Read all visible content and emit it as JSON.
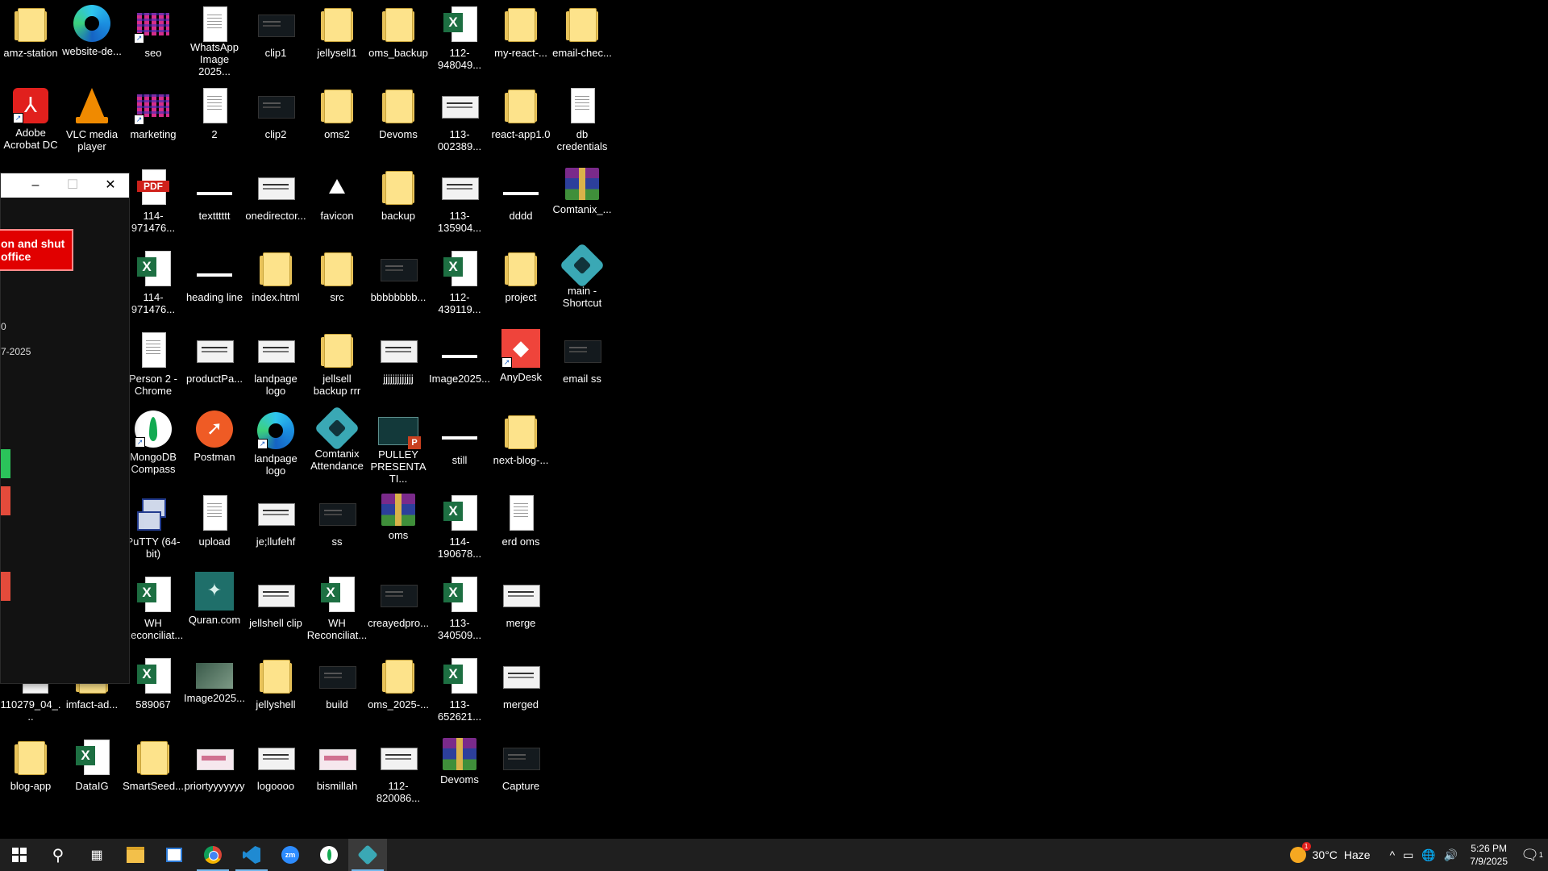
{
  "desktop_icons": [
    {
      "label": "amz-station",
      "type": "folder"
    },
    {
      "label": "website-de...",
      "type": "edge"
    },
    {
      "label": "seo",
      "type": "bars"
    },
    {
      "label": "WhatsApp Image 2025...",
      "type": "doc"
    },
    {
      "label": "clip1",
      "type": "darkimg"
    },
    {
      "label": "jellysell1",
      "type": "folder"
    },
    {
      "label": "oms_backup",
      "type": "folder"
    },
    {
      "label": "112-948049...",
      "type": "excel"
    },
    {
      "label": "my-react-...",
      "type": "folder"
    },
    {
      "label": "email-chec...",
      "type": "folder"
    },
    {
      "label": "Adobe Acrobat DC",
      "type": "acrobat"
    },
    {
      "label": "VLC media player",
      "type": "vlc"
    },
    {
      "label": "marketing",
      "type": "bars"
    },
    {
      "label": "2",
      "type": "doc"
    },
    {
      "label": "clip2",
      "type": "darkimg"
    },
    {
      "label": "oms2",
      "type": "folder"
    },
    {
      "label": "Devoms",
      "type": "folder"
    },
    {
      "label": "113-002389...",
      "type": "image"
    },
    {
      "label": "react-app1.0",
      "type": "folder"
    },
    {
      "label": "db credentials",
      "type": "doc"
    },
    {
      "label": "114-971476...",
      "type": "pdf"
    },
    {
      "label": "textttttt",
      "type": "line"
    },
    {
      "label": "onedirector...",
      "type": "image"
    },
    {
      "label": "favicon",
      "type": "tri"
    },
    {
      "label": "backup",
      "type": "folder"
    },
    {
      "label": "113-135904...",
      "type": "image"
    },
    {
      "label": "dddd",
      "type": "line"
    },
    {
      "label": "Comtanix_...",
      "type": "rar"
    },
    {
      "label": "114-971476...",
      "type": "excel"
    },
    {
      "label": "heading line",
      "type": "line"
    },
    {
      "label": "index.html",
      "type": "folder"
    },
    {
      "label": "src",
      "type": "folder"
    },
    {
      "label": "bbbbbbbb...",
      "type": "darkimg"
    },
    {
      "label": "112-439119...",
      "type": "excel"
    },
    {
      "label": "project",
      "type": "folder"
    },
    {
      "label": "main - Shortcut",
      "type": "comtanix"
    },
    {
      "label": "Person 2 - Chrome",
      "type": "doc"
    },
    {
      "label": "productPa...",
      "type": "image"
    },
    {
      "label": "landpage logo",
      "type": "image"
    },
    {
      "label": "jellsell backup rrr",
      "type": "folder"
    },
    {
      "label": "jjjjjjjjjjjjj",
      "type": "image"
    },
    {
      "label": "Image2025...",
      "type": "line"
    },
    {
      "label": "AnyDesk",
      "type": "anydesk"
    },
    {
      "label": "email ss",
      "type": "darkimg"
    },
    {
      "label": "MongoDB Compass",
      "type": "mongo"
    },
    {
      "label": "Postman",
      "type": "postman"
    },
    {
      "label": "landpage logo",
      "type": "edge"
    },
    {
      "label": "Comtanix Attendance",
      "type": "comtanix"
    },
    {
      "label": "PULLEY PRESENTATI...",
      "type": "ppt"
    },
    {
      "label": "still",
      "type": "line"
    },
    {
      "label": "next-blog-...",
      "type": "folder"
    },
    {
      "label": "PuTTY (64-bit)",
      "type": "putty"
    },
    {
      "label": "upload",
      "type": "doc"
    },
    {
      "label": "je;llufehf",
      "type": "image"
    },
    {
      "label": "ss",
      "type": "darkimg"
    },
    {
      "label": "oms",
      "type": "rar"
    },
    {
      "label": "114-190678...",
      "type": "excel"
    },
    {
      "label": "erd oms",
      "type": "doc"
    },
    {
      "label": "WH Reconciliat...",
      "type": "excel"
    },
    {
      "label": "Quran.com",
      "type": "quran"
    },
    {
      "label": "jellshell clip",
      "type": "image"
    },
    {
      "label": "WH Reconciliat...",
      "type": "excel"
    },
    {
      "label": "creayedpro...",
      "type": "darkimg"
    },
    {
      "label": "113-340509...",
      "type": "excel"
    },
    {
      "label": "merge",
      "type": "image"
    },
    {
      "label": "110279_04_...",
      "type": "excel"
    },
    {
      "label": "imfact-ad...",
      "type": "folder"
    },
    {
      "label": "589067",
      "type": "excel"
    },
    {
      "label": "Image2025...",
      "type": "green"
    },
    {
      "label": "jellyshell",
      "type": "folder"
    },
    {
      "label": "build",
      "type": "darkimg"
    },
    {
      "label": "oms_2025-...",
      "type": "folder"
    },
    {
      "label": "113-652621...",
      "type": "excel"
    },
    {
      "label": "merged",
      "type": "image"
    },
    {
      "label": "blog-app",
      "type": "folder"
    },
    {
      "label": "DataIG",
      "type": "excel"
    },
    {
      "label": "SmartSeed...",
      "type": "folder"
    },
    {
      "label": "priortyyyyyyy",
      "type": "pink"
    },
    {
      "label": "logoooo",
      "type": "image"
    },
    {
      "label": "bismillah",
      "type": "pink"
    },
    {
      "label": "112-820086...",
      "type": "image"
    },
    {
      "label": "Devoms",
      "type": "rar"
    },
    {
      "label": "Capture",
      "type": "darkimg"
    }
  ],
  "window": {
    "minimize_glyph": "–",
    "maximize_glyph": "☐",
    "close_glyph": "✕",
    "red_button_label": "on and shut office",
    "text_1": "0",
    "text_2": "7-2025"
  },
  "taskbar": {
    "start_label": "Start",
    "weather_temp": "30°C",
    "weather_desc": "Haze",
    "time": "5:26 PM",
    "date": "7/9/2025",
    "tray_chevron": "^",
    "notification_count": "1"
  },
  "colors": {
    "taskbar_bg": "#1f1f1f",
    "red_button": "#e10000",
    "active_indicator": "#76b9ed"
  }
}
